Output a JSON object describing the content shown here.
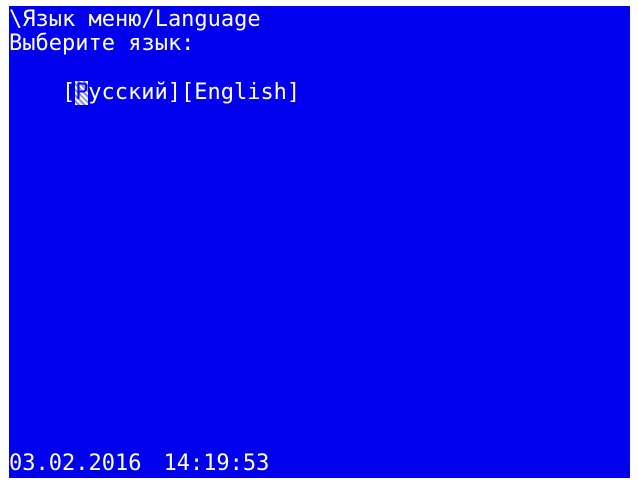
{
  "screen": {
    "title": "\\Язык меню/Language",
    "prompt": "Выберите язык:",
    "options": {
      "russian": {
        "open_bracket": "[",
        "cursor_char": "Р",
        "rest": "усский",
        "close_bracket": "]"
      },
      "english": {
        "label": "[English]"
      }
    },
    "status": {
      "date": "03.02.2016",
      "time": "14:19:53"
    }
  },
  "colors": {
    "background": "#0000ee",
    "text": "#ffffff",
    "frame": "#ffffff"
  }
}
